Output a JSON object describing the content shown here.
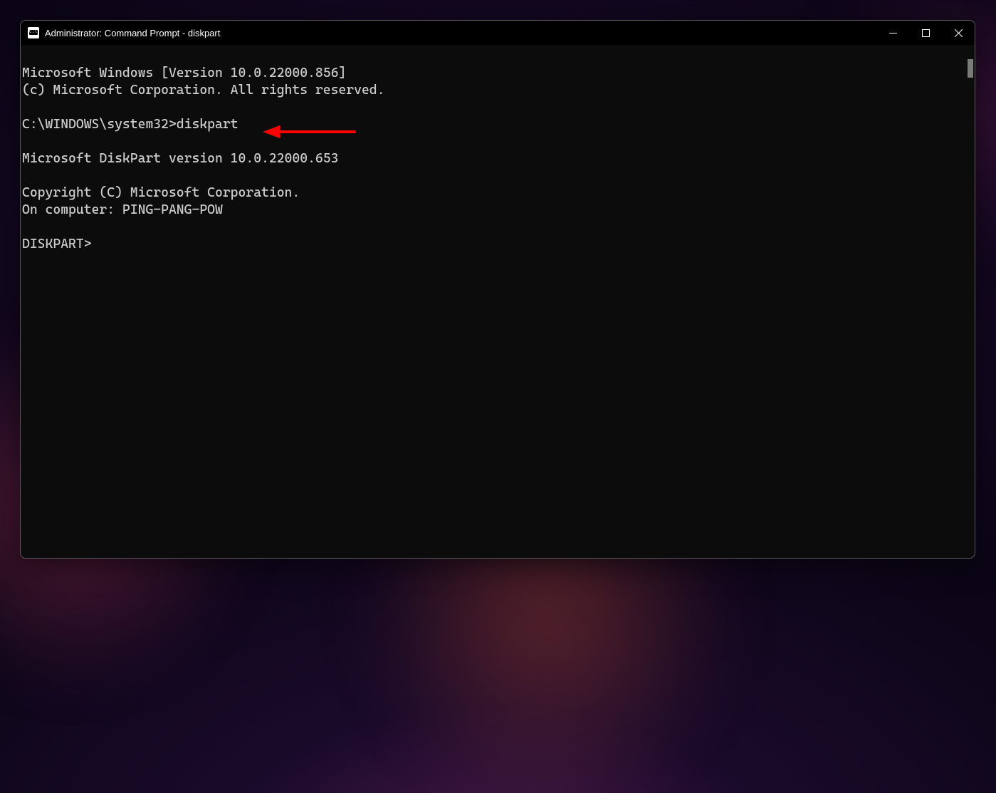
{
  "window": {
    "title": "Administrator: Command Prompt - diskpart"
  },
  "terminal": {
    "lines": [
      "Microsoft Windows [Version 10.0.22000.856]",
      "(c) Microsoft Corporation. All rights reserved.",
      "",
      "C:\\WINDOWS\\system32>diskpart",
      "",
      "Microsoft DiskPart version 10.0.22000.653",
      "",
      "Copyright (C) Microsoft Corporation.",
      "On computer: PING-PANG-POW",
      "",
      "DISKPART>"
    ]
  },
  "annotation": {
    "color": "#ff0000"
  }
}
